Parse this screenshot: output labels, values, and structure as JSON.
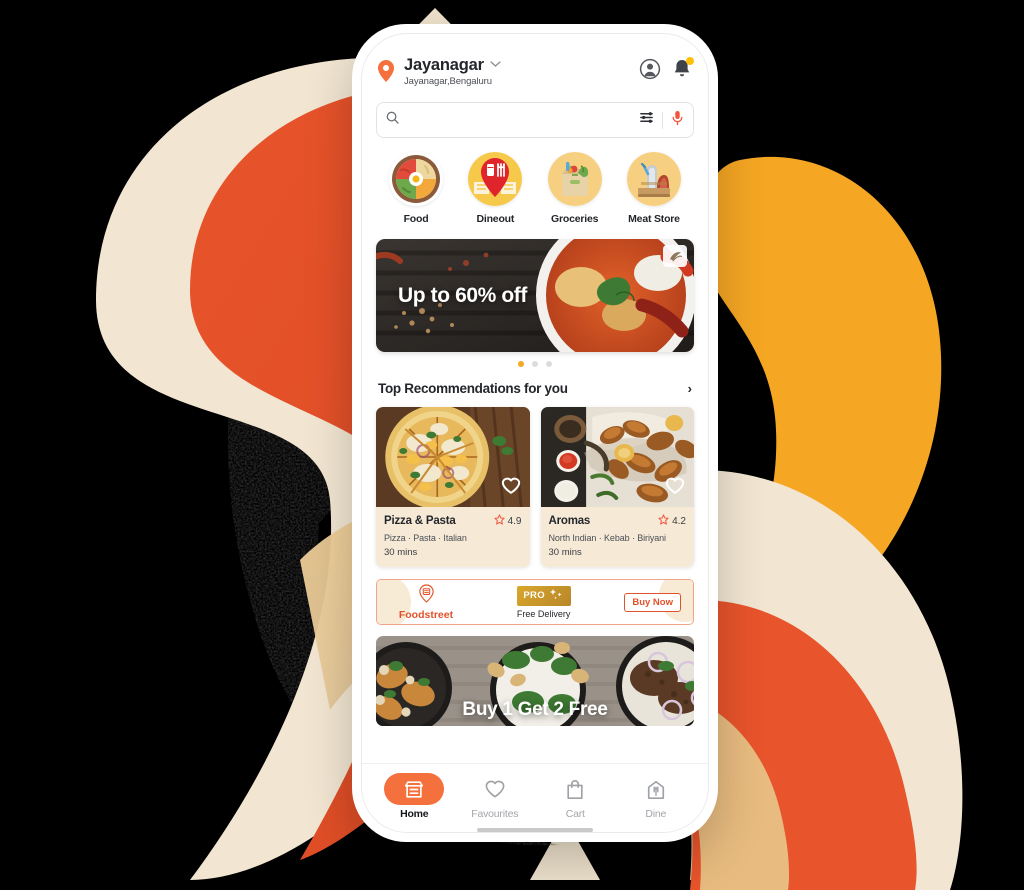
{
  "header": {
    "location_name": "Jayanagar",
    "location_sub": "Jayanagar,Bengaluru",
    "chevron": "⌄",
    "pin_icon": "location-pin-icon",
    "profile_icon": "profile-icon",
    "bell_icon": "notification-bell-icon"
  },
  "search": {
    "value": "",
    "placeholder": "",
    "search_icon": "search-icon",
    "filter_icon": "filter-sliders-icon",
    "mic_icon": "microphone-icon"
  },
  "categories": [
    {
      "label": "Food",
      "icon": "food-bowl-icon"
    },
    {
      "label": "Dineout",
      "icon": "dineout-pin-icon"
    },
    {
      "label": "Groceries",
      "icon": "grocery-bag-icon"
    },
    {
      "label": "Meat Store",
      "icon": "meat-store-icon"
    }
  ],
  "hero": {
    "title": "Up to 60% off",
    "dots": 3,
    "active_dot": 0,
    "logo_icon": "brand-logo-icon"
  },
  "section": {
    "title": "Top Recommendations for you",
    "chevron": "›"
  },
  "restaurants": [
    {
      "name": "Pizza & Pasta",
      "rating": "4.9",
      "tags": "Pizza  ·  Pasta  ·  Italian",
      "time": "30 mins",
      "favourite_icon": "heart-outline-icon",
      "star_icon": "star-icon"
    },
    {
      "name": "Aromas",
      "rating": "4.2",
      "tags": "North Indian  ·  Kebab  ·  Biriyani",
      "time": "30 mins",
      "favourite_icon": "heart-outline-icon",
      "star_icon": "star-icon"
    }
  ],
  "promo": {
    "brand": "Foodstreet",
    "brand_icon": "foodstreet-pin-icon",
    "badge": "PRO",
    "badge_icon": "sparkle-icon",
    "subtitle": "Free Delivery",
    "button": "Buy Now"
  },
  "hero2": {
    "title": "Buy 1 Get 2 Free"
  },
  "nav": [
    {
      "label": "Home",
      "icon": "store-icon",
      "active": true
    },
    {
      "label": "Favourites",
      "icon": "heart-outline-icon",
      "active": false
    },
    {
      "label": "Cart",
      "icon": "shopping-bag-icon",
      "active": false
    },
    {
      "label": "Dine",
      "icon": "dine-house-icon",
      "active": false
    }
  ],
  "colors": {
    "accent_orange": "#F4703C",
    "deep_orange": "#E2522A",
    "amber": "#F5A623",
    "cream": "#F2E6D2",
    "tan": "#E8C88A",
    "card_bg": "#F6EAD7"
  }
}
